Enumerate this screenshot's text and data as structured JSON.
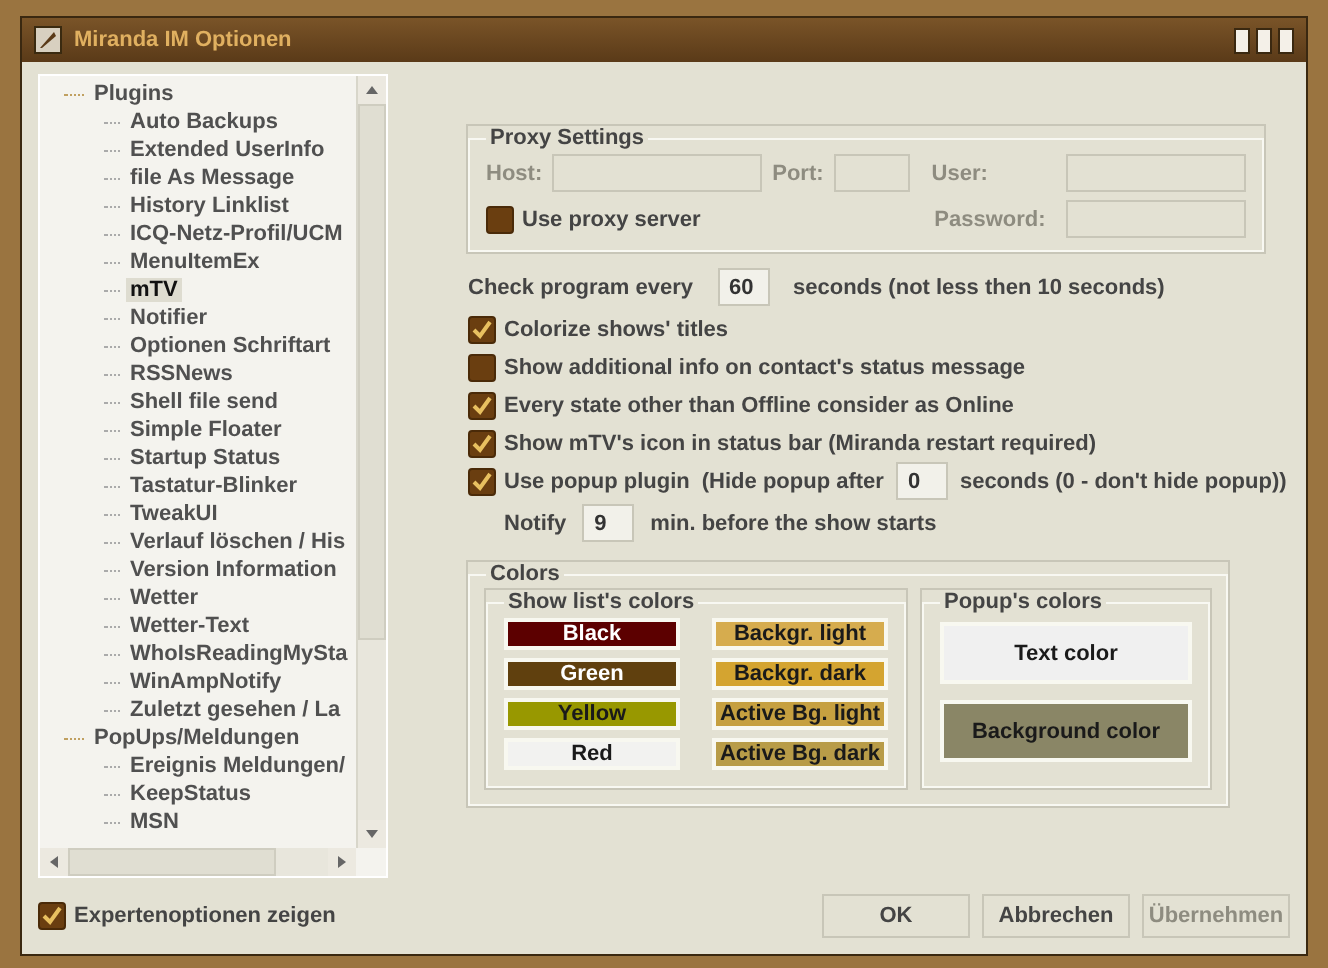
{
  "window": {
    "title": "Miranda IM Optionen"
  },
  "tree": [
    {
      "label": "Plugins",
      "children": [
        {
          "label": "Auto Backups",
          "selected": false
        },
        {
          "label": "Extended UserInfo",
          "selected": false
        },
        {
          "label": "file As Message",
          "selected": false
        },
        {
          "label": "History Linklist",
          "selected": false
        },
        {
          "label": "ICQ-Netz-Profil/UCM",
          "selected": false
        },
        {
          "label": "MenuItemEx",
          "selected": false
        },
        {
          "label": "mTV",
          "selected": true
        },
        {
          "label": "Notifier",
          "selected": false
        },
        {
          "label": "Optionen Schriftart",
          "selected": false
        },
        {
          "label": "RSSNews",
          "selected": false
        },
        {
          "label": "Shell file send",
          "selected": false
        },
        {
          "label": "Simple Floater",
          "selected": false
        },
        {
          "label": "Startup Status",
          "selected": false
        },
        {
          "label": "Tastatur-Blinker",
          "selected": false
        },
        {
          "label": "TweakUI",
          "selected": false
        },
        {
          "label": "Verlauf löschen / His",
          "selected": false
        },
        {
          "label": "Version Information",
          "selected": false
        },
        {
          "label": "Wetter",
          "selected": false
        },
        {
          "label": "Wetter-Text",
          "selected": false
        },
        {
          "label": "WhoIsReadingMySta",
          "selected": false
        },
        {
          "label": "WinAmpNotify",
          "selected": false
        },
        {
          "label": "Zuletzt gesehen / La",
          "selected": false
        }
      ]
    },
    {
      "label": "PopUps/Meldungen",
      "children": [
        {
          "label": "Ereignis Meldungen/",
          "selected": false
        },
        {
          "label": "KeepStatus",
          "selected": false
        },
        {
          "label": "MSN",
          "selected": false
        }
      ]
    }
  ],
  "expert_options": {
    "label": "Expertenoptionen zeigen",
    "checked": true
  },
  "proxy": {
    "title": "Proxy Settings",
    "disabled": true,
    "host_label": "Host:",
    "port_label": "Port:",
    "user_label": "User:",
    "password_label": "Password:",
    "use_proxy": {
      "label": "Use proxy server",
      "checked": false
    }
  },
  "check_interval": {
    "label": "Check program every",
    "value": "60",
    "suffix": "seconds (not less then 10 seconds)"
  },
  "options": [
    {
      "label": "Colorize shows' titles",
      "checked": true
    },
    {
      "label": "Show additional info on contact's status message",
      "checked": false
    },
    {
      "label": "Every state other than Offline consider as Online",
      "checked": true
    },
    {
      "label": "Show mTV's icon in status bar (Miranda restart required)",
      "checked": true
    }
  ],
  "popup": {
    "label": "Use popup plugin",
    "checked": true,
    "hide_prefix": "(Hide popup after",
    "hide_value": "0",
    "hide_suffix": "seconds (0 - don't hide popup))"
  },
  "notify": {
    "label": "Notify",
    "value": "9",
    "suffix": "min. before the show starts"
  },
  "colors": {
    "title": "Colors",
    "list_title": "Show list's colors",
    "list": [
      {
        "label": "Black",
        "color": "#5c0000"
      },
      {
        "label": "Backgr. light",
        "color": "#d6ac4e"
      },
      {
        "label": "Green",
        "color": "#60400e"
      },
      {
        "label": "Backgr. dark",
        "color": "#d4a430"
      },
      {
        "label": "Yellow",
        "color": "#989800"
      },
      {
        "label": "Active Bg. light",
        "color": "#c6a040"
      },
      {
        "label": "Red",
        "color": "#f2f2f0"
      },
      {
        "label": "Active Bg. dark",
        "color": "#b89c48"
      }
    ],
    "popup_title": "Popup's colors",
    "popup": [
      {
        "label": "Text color",
        "color": "#f0f0f0"
      },
      {
        "label": "Background color",
        "color": "#8a8666"
      }
    ]
  },
  "buttons": [
    {
      "label": "OK",
      "disabled": false
    },
    {
      "label": "Abbrechen",
      "disabled": false
    },
    {
      "label": "Übernehmen",
      "disabled": true
    }
  ]
}
